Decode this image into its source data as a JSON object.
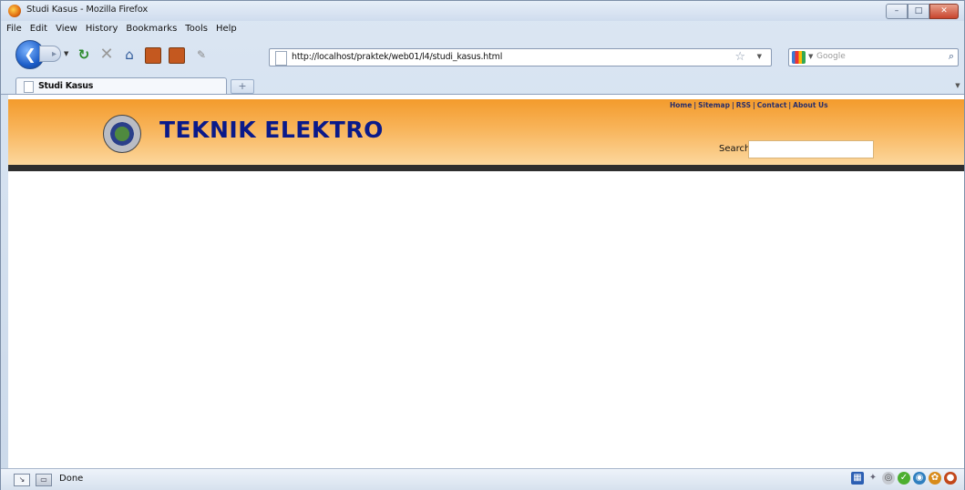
{
  "window": {
    "title": "Studi Kasus - Mozilla Firefox",
    "controls": [
      "–",
      "□",
      "✕"
    ]
  },
  "menubar": {
    "items": [
      "File",
      "Edit",
      "View",
      "History",
      "Bookmarks",
      "Tools",
      "Help"
    ]
  },
  "toolbar": {
    "back_icon": "back-arrow-icon",
    "forward_icon": "forward-arrow-icon",
    "url": "http://localhost/praktek/web01/l4/studi_kasus.html",
    "search_placeholder": "Google"
  },
  "tabs": {
    "active_label": "Studi Kasus",
    "new_tab": "+"
  },
  "page": {
    "header_color": "#f39b2c",
    "site_title": "TEKNIK ELEKTRO",
    "top_links": [
      "Home",
      "Sitemap",
      "RSS",
      "Contact",
      "About Us"
    ],
    "search_label": "Search"
  },
  "statusbar": {
    "text": "Done"
  }
}
